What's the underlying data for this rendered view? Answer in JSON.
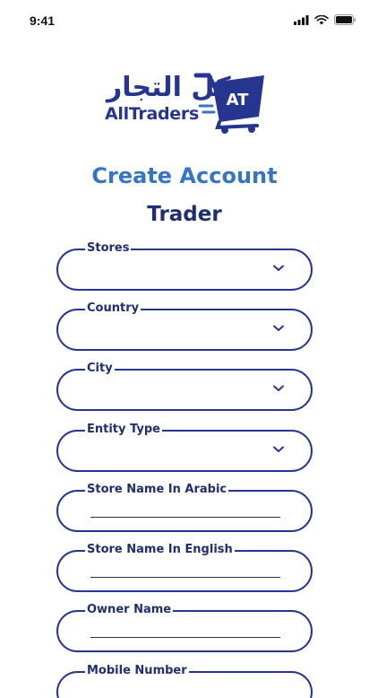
{
  "status": {
    "time": "9:41"
  },
  "logo": {
    "arabic": "كل التجار",
    "latin": "AllTraders",
    "badge": "AT"
  },
  "header": {
    "title": "Create Account",
    "subtitle": "Trader"
  },
  "fields": {
    "stores": {
      "label": "Stores",
      "value": ""
    },
    "country": {
      "label": "Country",
      "value": ""
    },
    "city": {
      "label": "City",
      "value": ""
    },
    "entity_type": {
      "label": "Entity Type",
      "value": ""
    },
    "store_name_ar": {
      "label": "Store Name In Arabic",
      "value": ""
    },
    "store_name_en": {
      "label": "Store Name In English",
      "value": ""
    },
    "owner_name": {
      "label": "Owner Name",
      "value": ""
    },
    "mobile": {
      "label": "Mobile Number",
      "value": ""
    }
  },
  "colors": {
    "primary": "#26368e",
    "accent": "#3575c3"
  },
  "icons": [
    "signal-icon",
    "wifi-icon",
    "battery-icon",
    "cart-icon",
    "chevron-down-icon"
  ]
}
